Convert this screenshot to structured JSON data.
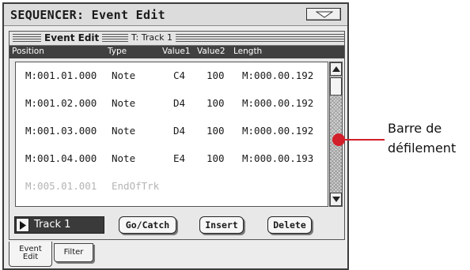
{
  "window": {
    "title": "SEQUENCER: Event Edit"
  },
  "panel": {
    "title": "Event Edit",
    "track": "T: Track 1"
  },
  "columns": {
    "position": "Position",
    "type": "Type",
    "value1": "Value1",
    "value2": "Value2",
    "length": "Length"
  },
  "events": [
    {
      "position": "M:001.01.000",
      "type": "Note",
      "value1": "C4",
      "value2": "100",
      "length": "M:000.00.192"
    },
    {
      "position": "M:001.02.000",
      "type": "Note",
      "value1": "D4",
      "value2": "100",
      "length": "M:000.00.192"
    },
    {
      "position": "M:001.03.000",
      "type": "Note",
      "value1": "D4",
      "value2": "100",
      "length": "M:000.00.192"
    },
    {
      "position": "M:001.04.000",
      "type": "Note",
      "value1": "E4",
      "value2": "100",
      "length": "M:000.00.193"
    },
    {
      "position": "M:005.01.001",
      "type": "EndOfTrk",
      "value1": "",
      "value2": "",
      "length": ""
    }
  ],
  "controls": {
    "track_select": "Track 1",
    "go_catch": "Go/Catch",
    "insert": "Insert",
    "delete": "Delete"
  },
  "tabs": {
    "event_edit": [
      "Event",
      "Edit"
    ],
    "filter": "Filter"
  },
  "annotation": {
    "line1": "Barre de",
    "line2": "défilement",
    "color": "#d21f2a"
  },
  "icons": {
    "menu": "menu-triangle-icon",
    "scroll_up": "arrow-up-icon",
    "scroll_down": "arrow-down-icon",
    "track": "play-triangle-icon"
  }
}
